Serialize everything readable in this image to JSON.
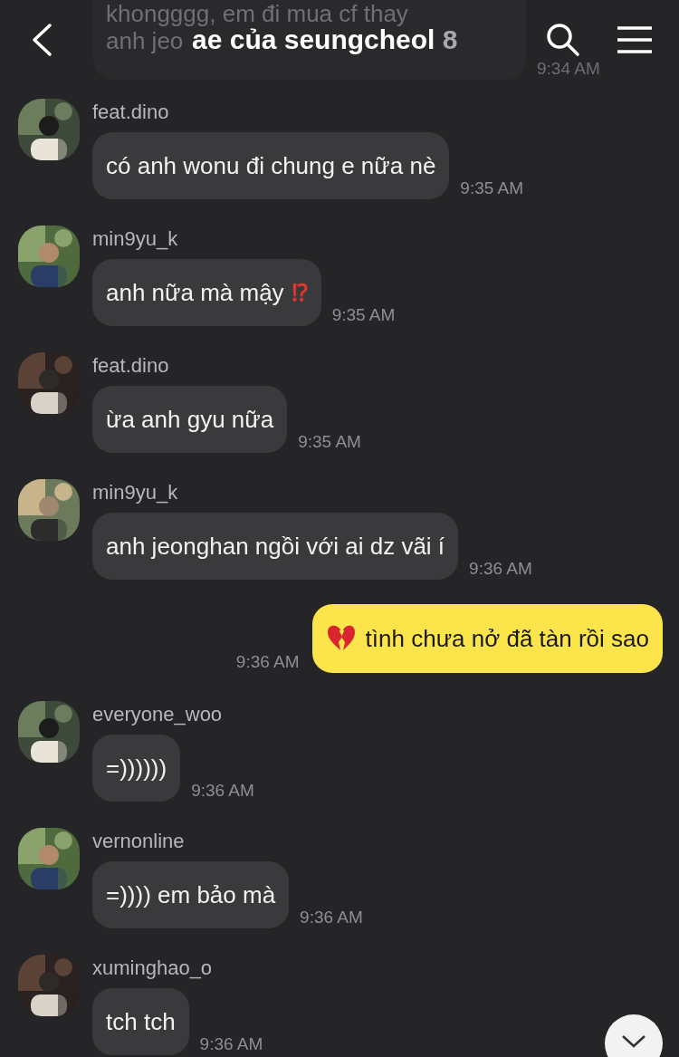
{
  "header": {
    "title": "ae của seungcheol",
    "member_count": "8"
  },
  "faded_message": {
    "lines": [
      "khongggg, em đi mua cf thay",
      "anh jeo"
    ],
    "time": "9:34 AM"
  },
  "messages": [
    {
      "kind": "received",
      "sender": "feat.dino",
      "text": "có anh wonu đi chung e nữa nè",
      "time": "9:35 AM"
    },
    {
      "kind": "received",
      "sender": "min9yu_k",
      "text": "anh nữa mà mậy",
      "mark": "⁉",
      "time": "9:35 AM"
    },
    {
      "kind": "received",
      "sender": "feat.dino",
      "text": "ừa anh gyu nữa",
      "time": "9:35 AM"
    },
    {
      "kind": "received",
      "sender": "min9yu_k",
      "text": "anh jeonghan ngồi với ai dz vãi í",
      "time": "9:36 AM"
    },
    {
      "kind": "sent",
      "text": "tình chưa nở đã tàn rồi sao",
      "time": "9:36 AM"
    },
    {
      "kind": "received",
      "sender": "everyone_woo",
      "text": "=))))))",
      "time": "9:36 AM"
    },
    {
      "kind": "received",
      "sender": "vernonline",
      "text": "=)))) em bảo mà",
      "time": "9:36 AM"
    },
    {
      "kind": "received",
      "sender": "xuminghao_o",
      "text": "tch tch",
      "time": "9:36 AM"
    }
  ]
}
